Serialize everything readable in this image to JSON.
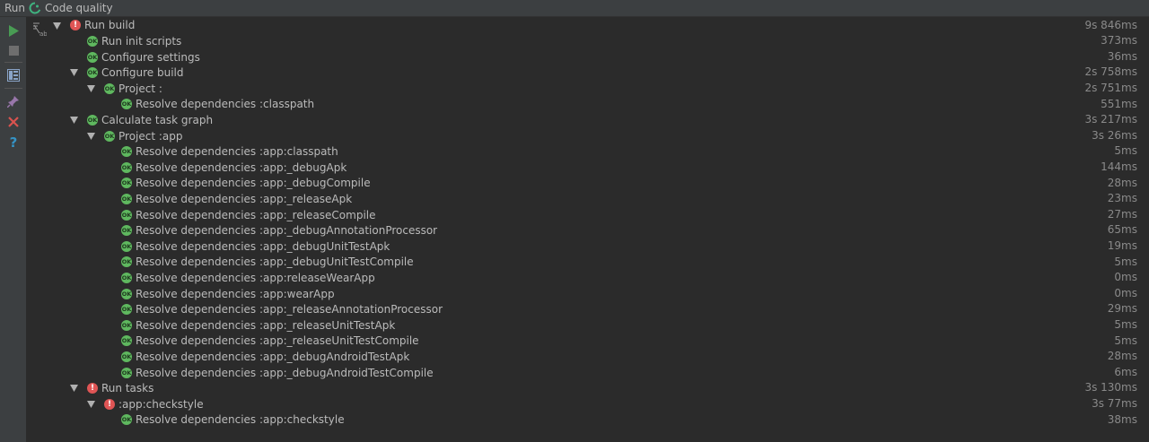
{
  "window": {
    "title_run": "Run",
    "title_config": "Code quality"
  },
  "toolbar": {
    "buttons": [
      {
        "name": "rerun-icon"
      },
      {
        "name": "stop-icon"
      },
      {
        "name": "layout-icon"
      },
      {
        "name": "pin-icon"
      },
      {
        "name": "close-icon"
      },
      {
        "name": "help-icon"
      }
    ]
  },
  "colors": {
    "ok": "#5fb85f",
    "error": "#e05555",
    "background": "#2b2b2b",
    "toolbar": "#3c3f41"
  },
  "tree": {
    "nodes": [
      {
        "label": "Run build",
        "time": "9s 846ms",
        "status": "error",
        "depth": 0,
        "expanded": true
      },
      {
        "label": "Run init scripts",
        "time": "373ms",
        "status": "ok",
        "depth": 1,
        "expanded": null
      },
      {
        "label": "Configure settings",
        "time": "36ms",
        "status": "ok",
        "depth": 1,
        "expanded": null
      },
      {
        "label": "Configure build",
        "time": "2s 758ms",
        "status": "ok",
        "depth": 1,
        "expanded": true
      },
      {
        "label": "Project :",
        "time": "2s 751ms",
        "status": "ok",
        "depth": 2,
        "expanded": true
      },
      {
        "label": "Resolve dependencies :classpath",
        "time": "551ms",
        "status": "ok",
        "depth": 3,
        "expanded": null
      },
      {
        "label": "Calculate task graph",
        "time": "3s 217ms",
        "status": "ok",
        "depth": 1,
        "expanded": true
      },
      {
        "label": "Project :app",
        "time": "3s 26ms",
        "status": "ok",
        "depth": 2,
        "expanded": true
      },
      {
        "label": "Resolve dependencies :app:classpath",
        "time": "5ms",
        "status": "ok",
        "depth": 3,
        "expanded": null
      },
      {
        "label": "Resolve dependencies :app:_debugApk",
        "time": "144ms",
        "status": "ok",
        "depth": 3,
        "expanded": null
      },
      {
        "label": "Resolve dependencies :app:_debugCompile",
        "time": "28ms",
        "status": "ok",
        "depth": 3,
        "expanded": null
      },
      {
        "label": "Resolve dependencies :app:_releaseApk",
        "time": "23ms",
        "status": "ok",
        "depth": 3,
        "expanded": null
      },
      {
        "label": "Resolve dependencies :app:_releaseCompile",
        "time": "27ms",
        "status": "ok",
        "depth": 3,
        "expanded": null
      },
      {
        "label": "Resolve dependencies :app:_debugAnnotationProcessor",
        "time": "65ms",
        "status": "ok",
        "depth": 3,
        "expanded": null
      },
      {
        "label": "Resolve dependencies :app:_debugUnitTestApk",
        "time": "19ms",
        "status": "ok",
        "depth": 3,
        "expanded": null
      },
      {
        "label": "Resolve dependencies :app:_debugUnitTestCompile",
        "time": "5ms",
        "status": "ok",
        "depth": 3,
        "expanded": null
      },
      {
        "label": "Resolve dependencies :app:releaseWearApp",
        "time": "0ms",
        "status": "ok",
        "depth": 3,
        "expanded": null
      },
      {
        "label": "Resolve dependencies :app:wearApp",
        "time": "0ms",
        "status": "ok",
        "depth": 3,
        "expanded": null
      },
      {
        "label": "Resolve dependencies :app:_releaseAnnotationProcessor",
        "time": "29ms",
        "status": "ok",
        "depth": 3,
        "expanded": null
      },
      {
        "label": "Resolve dependencies :app:_releaseUnitTestApk",
        "time": "5ms",
        "status": "ok",
        "depth": 3,
        "expanded": null
      },
      {
        "label": "Resolve dependencies :app:_releaseUnitTestCompile",
        "time": "5ms",
        "status": "ok",
        "depth": 3,
        "expanded": null
      },
      {
        "label": "Resolve dependencies :app:_debugAndroidTestApk",
        "time": "28ms",
        "status": "ok",
        "depth": 3,
        "expanded": null
      },
      {
        "label": "Resolve dependencies :app:_debugAndroidTestCompile",
        "time": "6ms",
        "status": "ok",
        "depth": 3,
        "expanded": null
      },
      {
        "label": "Run tasks",
        "time": "3s 130ms",
        "status": "error",
        "depth": 1,
        "expanded": true
      },
      {
        "label": ":app:checkstyle",
        "time": "3s 77ms",
        "status": "error",
        "depth": 2,
        "expanded": true
      },
      {
        "label": "Resolve dependencies :app:checkstyle",
        "time": "38ms",
        "status": "ok",
        "depth": 3,
        "expanded": null
      }
    ]
  }
}
